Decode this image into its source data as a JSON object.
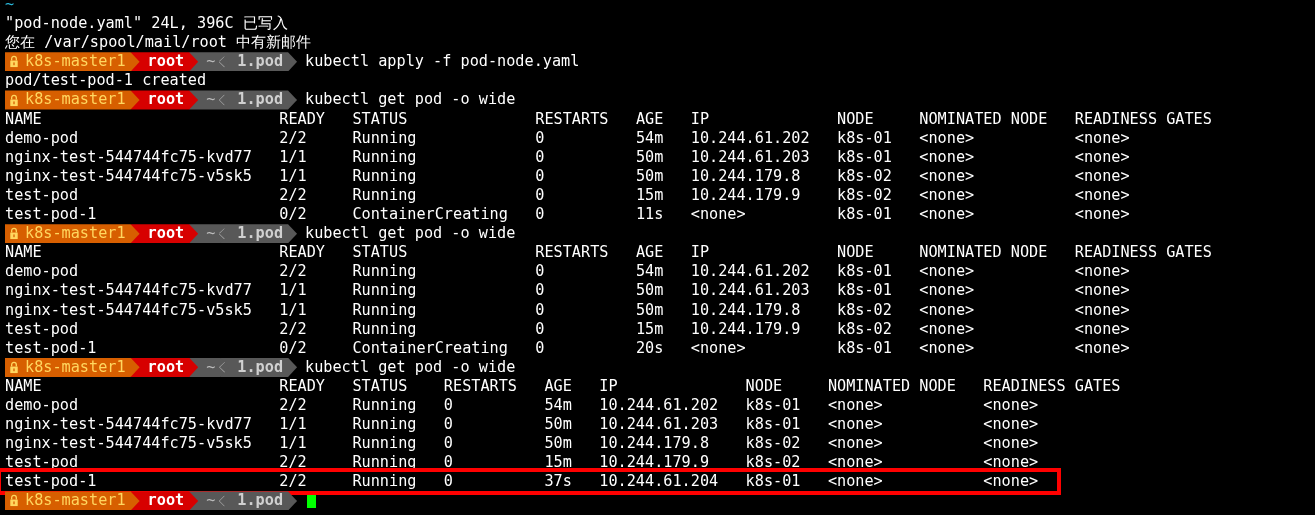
{
  "terminal": {
    "lines": [
      {
        "kind": "vim_tilde",
        "text": "~"
      },
      {
        "kind": "text",
        "text": "\"pod-node.yaml\" 24L, 396C 已写入"
      },
      {
        "kind": "text",
        "text": "您在 /var/spool/mail/root 中有新邮件"
      },
      {
        "kind": "prompt",
        "host": "k8s-master1",
        "user": "root",
        "home": "~",
        "folder": "1.pod",
        "command": "kubectl apply -f pod-node.yaml"
      },
      {
        "kind": "text",
        "text": "pod/test-pod-1 created"
      },
      {
        "kind": "prompt",
        "host": "k8s-master1",
        "user": "root",
        "home": "~",
        "folder": "1.pod",
        "command": "kubectl get pod -o wide"
      },
      {
        "kind": "table",
        "columns": [
          "NAME",
          "READY",
          "STATUS",
          "RESTARTS",
          "AGE",
          "IP",
          "NODE",
          "NOMINATED NODE",
          "READINESS GATES"
        ],
        "rows": [
          {
            "cells": [
              "demo-pod",
              "2/2",
              "Running",
              "0",
              "54m",
              "10.244.61.202",
              "k8s-01",
              "<none>",
              "<none>"
            ],
            "highlighted": false
          },
          {
            "cells": [
              "nginx-test-544744fc75-kvd77",
              "1/1",
              "Running",
              "0",
              "50m",
              "10.244.61.203",
              "k8s-01",
              "<none>",
              "<none>"
            ],
            "highlighted": false
          },
          {
            "cells": [
              "nginx-test-544744fc75-v5sk5",
              "1/1",
              "Running",
              "0",
              "50m",
              "10.244.179.8",
              "k8s-02",
              "<none>",
              "<none>"
            ],
            "highlighted": false
          },
          {
            "cells": [
              "test-pod",
              "2/2",
              "Running",
              "0",
              "15m",
              "10.244.179.9",
              "k8s-02",
              "<none>",
              "<none>"
            ],
            "highlighted": false
          },
          {
            "cells": [
              "test-pod-1",
              "0/2",
              "ContainerCreating",
              "0",
              "11s",
              "<none>",
              "k8s-01",
              "<none>",
              "<none>"
            ],
            "highlighted": false
          }
        ]
      },
      {
        "kind": "prompt",
        "host": "k8s-master1",
        "user": "root",
        "home": "~",
        "folder": "1.pod",
        "command": "kubectl get pod -o wide"
      },
      {
        "kind": "table",
        "columns": [
          "NAME",
          "READY",
          "STATUS",
          "RESTARTS",
          "AGE",
          "IP",
          "NODE",
          "NOMINATED NODE",
          "READINESS GATES"
        ],
        "rows": [
          {
            "cells": [
              "demo-pod",
              "2/2",
              "Running",
              "0",
              "54m",
              "10.244.61.202",
              "k8s-01",
              "<none>",
              "<none>"
            ],
            "highlighted": false
          },
          {
            "cells": [
              "nginx-test-544744fc75-kvd77",
              "1/1",
              "Running",
              "0",
              "50m",
              "10.244.61.203",
              "k8s-01",
              "<none>",
              "<none>"
            ],
            "highlighted": false
          },
          {
            "cells": [
              "nginx-test-544744fc75-v5sk5",
              "1/1",
              "Running",
              "0",
              "50m",
              "10.244.179.8",
              "k8s-02",
              "<none>",
              "<none>"
            ],
            "highlighted": false
          },
          {
            "cells": [
              "test-pod",
              "2/2",
              "Running",
              "0",
              "15m",
              "10.244.179.9",
              "k8s-02",
              "<none>",
              "<none>"
            ],
            "highlighted": false
          },
          {
            "cells": [
              "test-pod-1",
              "0/2",
              "ContainerCreating",
              "0",
              "20s",
              "<none>",
              "k8s-01",
              "<none>",
              "<none>"
            ],
            "highlighted": false
          }
        ]
      },
      {
        "kind": "prompt",
        "host": "k8s-master1",
        "user": "root",
        "home": "~",
        "folder": "1.pod",
        "command": "kubectl get pod -o wide"
      },
      {
        "kind": "table",
        "columns": [
          "NAME",
          "READY",
          "STATUS",
          "RESTARTS",
          "AGE",
          "IP",
          "NODE",
          "NOMINATED NODE",
          "READINESS GATES"
        ],
        "rows": [
          {
            "cells": [
              "demo-pod",
              "2/2",
              "Running",
              "0",
              "54m",
              "10.244.61.202",
              "k8s-01",
              "<none>",
              "<none>"
            ],
            "highlighted": false
          },
          {
            "cells": [
              "nginx-test-544744fc75-kvd77",
              "1/1",
              "Running",
              "0",
              "50m",
              "10.244.61.203",
              "k8s-01",
              "<none>",
              "<none>"
            ],
            "highlighted": false
          },
          {
            "cells": [
              "nginx-test-544744fc75-v5sk5",
              "1/1",
              "Running",
              "0",
              "50m",
              "10.244.179.8",
              "k8s-02",
              "<none>",
              "<none>"
            ],
            "highlighted": false
          },
          {
            "cells": [
              "test-pod",
              "2/2",
              "Running",
              "0",
              "15m",
              "10.244.179.9",
              "k8s-02",
              "<none>",
              "<none>"
            ],
            "highlighted": false
          },
          {
            "cells": [
              "test-pod-1",
              "2/2",
              "Running",
              "0",
              "37s",
              "10.244.61.204",
              "k8s-01",
              "<none>",
              "<none>"
            ],
            "highlighted": true
          }
        ]
      },
      {
        "kind": "prompt",
        "host": "k8s-master1",
        "user": "root",
        "home": "~",
        "folder": "1.pod",
        "cursor": true
      }
    ]
  }
}
